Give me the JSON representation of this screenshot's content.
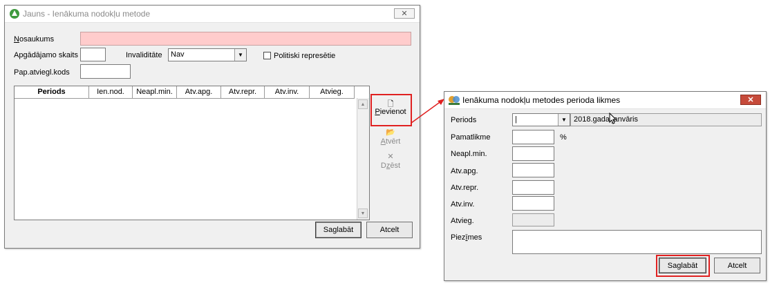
{
  "win1": {
    "title": "Jauns - Ienākuma nodokļu metode",
    "nosaukums_label": "Nosaukums",
    "apgadajamo_label": "Apgādājamo skaits",
    "invaliditate_label": "Invaliditāte",
    "invaliditate_value": "Nav",
    "politiski_label": "Politiski represētie",
    "pap_label": "Pap.atviegl.kods",
    "columns": [
      "Periods",
      "Ien.nod.",
      "Neapl.min.",
      "Atv.apg.",
      "Atv.repr.",
      "Atv.inv.",
      "Atvieg."
    ],
    "pievienot_label": "Pievienot",
    "atvert_label": "Atvērt",
    "dzest_label": "Dzēst",
    "saglabat_label": "Saglabāt",
    "atcelt_label": "Atcelt"
  },
  "win2": {
    "title": "Ienākuma nodokļu metodes perioda likmes",
    "periods_label": "Periods",
    "periods_display": "2018.gada janvāris",
    "pamatlikme_label": "Pamatlikme",
    "percent": "%",
    "neapl_label": "Neapl.min.",
    "atvapg_label": "Atv.apg.",
    "atvrepr_label": "Atv.repr.",
    "atvinv_label": "Atv.inv.",
    "atvieg_label": "Atvieg.",
    "piezimes_label": "Piezīmes",
    "saglabat_label": "Saglabāt",
    "atcelt_label": "Atcelt"
  },
  "colors": {
    "highlight": "#e02020",
    "required_field": "#ffcccc",
    "window_bg": "#f0f0f0"
  }
}
